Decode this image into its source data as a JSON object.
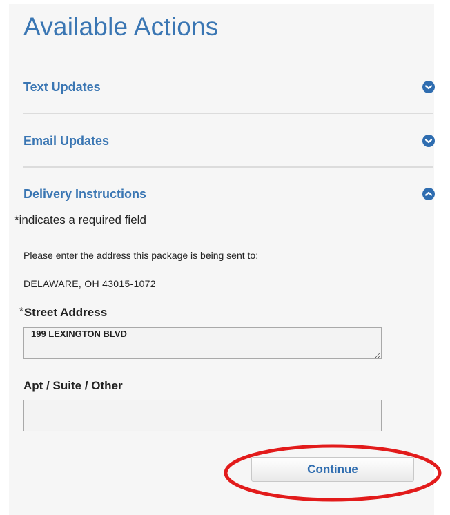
{
  "header": {
    "title": "Available Actions"
  },
  "accordion": {
    "items": [
      {
        "label": "Text Updates",
        "state": "collapsed",
        "icon": "chevron-down-circle-icon"
      },
      {
        "label": "Email Updates",
        "state": "collapsed",
        "icon": "chevron-down-circle-icon"
      },
      {
        "label": "Delivery Instructions",
        "state": "expanded",
        "icon": "chevron-up-circle-icon"
      }
    ]
  },
  "delivery": {
    "required_note": "*indicates a required field",
    "prompt": "Please enter the address this package is being sent to:",
    "city_line": "DELAWARE,  OH  43015-1072",
    "street": {
      "required_marker": "*",
      "label": "Street Address",
      "value": "199 LEXINGTON BLVD"
    },
    "apt": {
      "label": "Apt / Suite / Other",
      "value": ""
    },
    "continue_label": "Continue"
  },
  "colors": {
    "accent": "#3a76b3",
    "icon": "#2f6db0",
    "highlight": "#e21b1b"
  }
}
